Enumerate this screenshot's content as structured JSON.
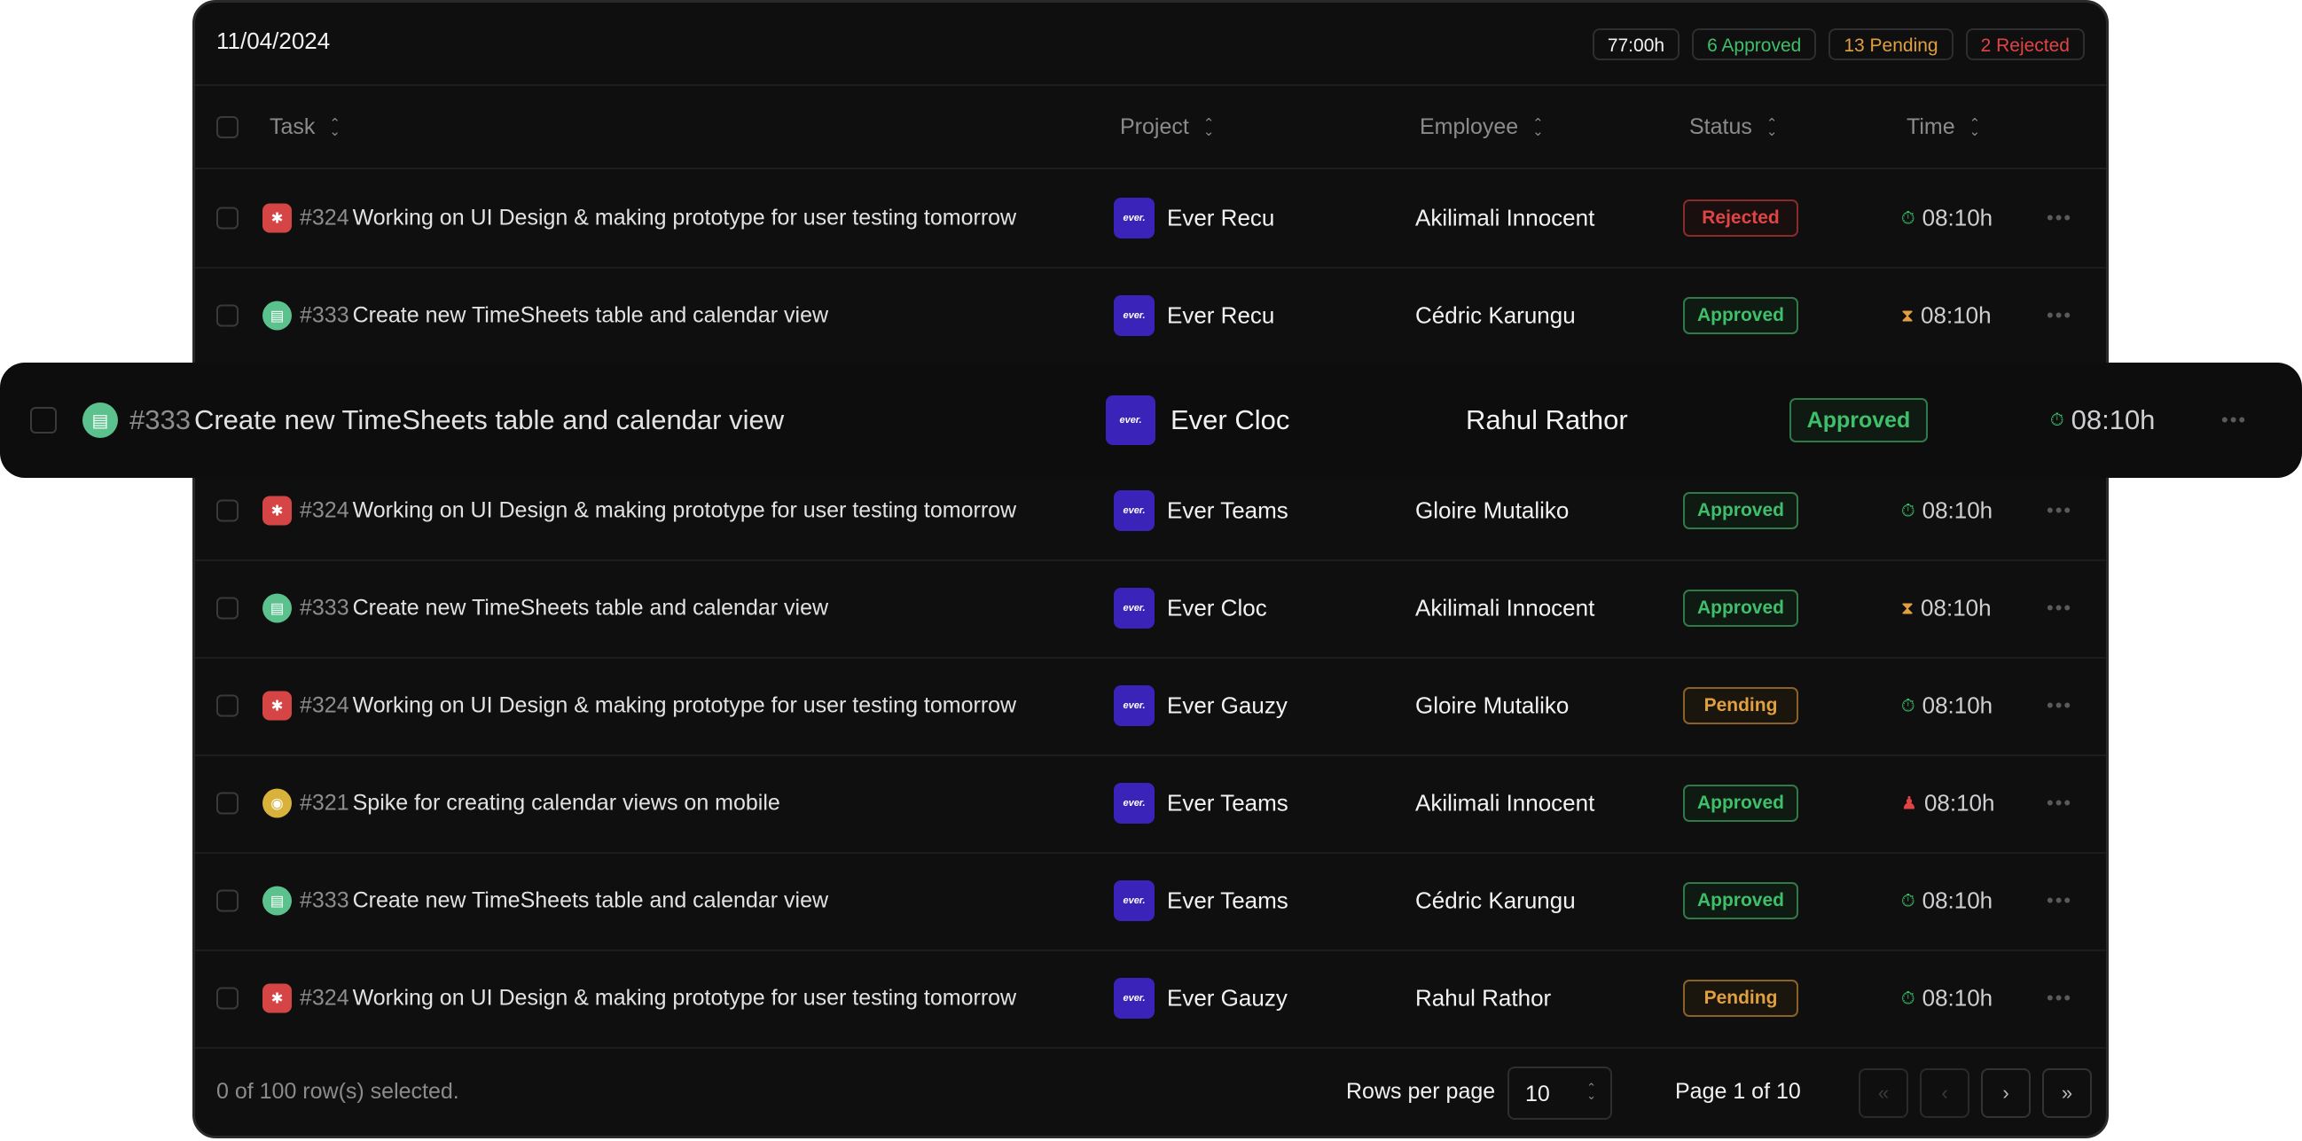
{
  "header": {
    "date": "11/04/2024",
    "total_hours": "77:00h",
    "approved": "6 Approved",
    "pending": "13 Pending",
    "rejected": "2 Rejected"
  },
  "columns": {
    "task": "Task",
    "project": "Project",
    "employee": "Employee",
    "status": "Status",
    "time": "Time"
  },
  "logo_text": "ever",
  "colors": {
    "approved": "#3fbf6a",
    "pending": "#e0a040",
    "rejected": "#e04444",
    "project_logo": "#3a23b8"
  },
  "rows": [
    {
      "task_icon": "bug-icon",
      "task_num": "#324",
      "task_title": "Working on UI Design & making prototype for user testing tomorrow",
      "project": "Ever Recu",
      "employee": "Akilimali Innocent",
      "status": "Rejected",
      "time_icon": "timer-icon",
      "time": "08:10h"
    },
    {
      "task_icon": "story-icon",
      "task_num": "#333",
      "task_title": "Create new TimeSheets table and calendar view",
      "project": "Ever Recu",
      "employee": "Cédric Karungu",
      "status": "Approved",
      "time_icon": "hourglass-icon",
      "time": "08:10h"
    },
    {
      "task_icon": "bug-icon",
      "task_num": "#324",
      "task_title": "Working on UI Design & making prototype for user testing tomorrow",
      "project": "Ever Teams",
      "employee": "Gloire Mutaliko",
      "status": "Approved",
      "time_icon": "timer-icon",
      "time": "08:10h"
    },
    {
      "task_icon": "story-icon",
      "task_num": "#333",
      "task_title": "Create new TimeSheets table and calendar view",
      "project": "Ever Cloc",
      "employee": "Akilimali Innocent",
      "status": "Approved",
      "time_icon": "hourglass-icon",
      "time": "08:10h"
    },
    {
      "task_icon": "bug-icon",
      "task_num": "#324",
      "task_title": "Working on UI Design & making prototype for user testing tomorrow",
      "project": "Ever Gauzy",
      "employee": "Gloire Mutaliko",
      "status": "Pending",
      "time_icon": "timer-icon",
      "time": "08:10h"
    },
    {
      "task_icon": "idea-icon",
      "task_num": "#321",
      "task_title": "Spike for creating calendar views on mobile",
      "project": "Ever Teams",
      "employee": "Akilimali Innocent",
      "status": "Approved",
      "time_icon": "user-icon",
      "time": "08:10h"
    },
    {
      "task_icon": "story-icon",
      "task_num": "#333",
      "task_title": "Create new TimeSheets table and calendar view",
      "project": "Ever Teams",
      "employee": "Cédric Karungu",
      "status": "Approved",
      "time_icon": "timer-icon",
      "time": "08:10h"
    },
    {
      "task_icon": "bug-icon",
      "task_num": "#324",
      "task_title": "Working on UI Design & making prototype for user testing tomorrow",
      "project": "Ever Gauzy",
      "employee": "Rahul Rathor",
      "status": "Pending",
      "time_icon": "timer-icon",
      "time": "08:10h"
    }
  ],
  "dragged_row": {
    "task_icon": "story-icon",
    "task_num": "#333",
    "task_title": "Create new TimeSheets table and calendar view",
    "project": "Ever Cloc",
    "employee": "Rahul Rathor",
    "status": "Approved",
    "time_icon": "timer-icon",
    "time": "08:10h"
  },
  "footer": {
    "selection": "0 of 100 row(s) selected.",
    "rows_per_page_label": "Rows per page",
    "rows_per_page_value": "10",
    "page_info": "Page 1 of 10"
  }
}
